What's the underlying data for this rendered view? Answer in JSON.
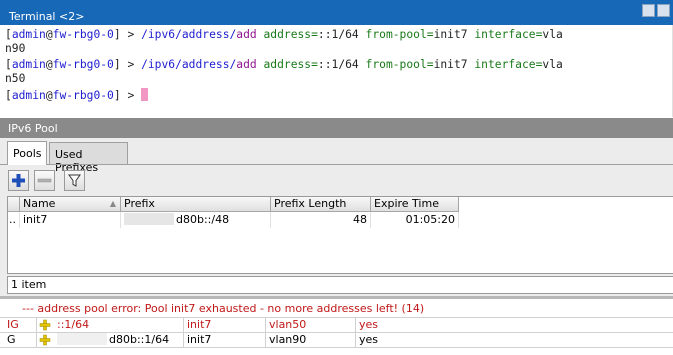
{
  "terminal": {
    "title": "Terminal <2>",
    "lines": [
      {
        "l": "[",
        "user": "admin",
        "at": "@",
        "host": "fw-rbg0-0",
        "r": "] > ",
        "path": "/ipv6/address/",
        "cmd": "add",
        "args": [
          {
            "k": " address=",
            "v": "::1/64"
          },
          {
            "k": " from-pool=",
            "v": "init7"
          },
          {
            "k": " interface=",
            "v": "vla"
          }
        ],
        "wrap": "n90"
      },
      {
        "l": "[",
        "user": "admin",
        "at": "@",
        "host": "fw-rbg0-0",
        "r": "] > ",
        "path": "/ipv6/address/",
        "cmd": "add",
        "args": [
          {
            "k": " address=",
            "v": "::1/64"
          },
          {
            "k": " from-pool=",
            "v": "init7"
          },
          {
            "k": " interface=",
            "v": "vla"
          }
        ],
        "wrap": "n50"
      }
    ],
    "prompt": {
      "l": "[",
      "user": "admin",
      "at": "@",
      "host": "fw-rbg0-0",
      "r": "] > "
    }
  },
  "pool_window": {
    "title": "IPv6 Pool",
    "tabs": [
      "Pools",
      "Used Prefixes"
    ],
    "active_tab": 0,
    "toolbar": [
      "add-icon",
      "remove-icon",
      "filter-icon"
    ],
    "columns": [
      "Name",
      "Prefix",
      "Prefix Length",
      "Expire Time"
    ],
    "rows": [
      {
        "marker": "..",
        "name": "init7",
        "prefix": "d80b::/48",
        "prefix_length": "48",
        "expire_time": "01:05:20"
      }
    ],
    "status": "1 item"
  },
  "log": {
    "error": "--- address pool error: Pool init7 exhausted - no more addresses left! (14)",
    "rows": [
      {
        "flags": "IG",
        "address": "::1/64",
        "pool": "init7",
        "interface": "vlan50",
        "advertise": "yes",
        "invalid": true
      },
      {
        "flags": "G",
        "address": "d80b::1/64",
        "pool": "init7",
        "interface": "vlan90",
        "advertise": "yes",
        "invalid": false
      }
    ]
  },
  "colors": {
    "title_active": "#1868b8",
    "title_inactive": "#8a8a8a",
    "error": "#c01818",
    "cursor": "#f296c4",
    "add_icon": "#1e4fb8"
  }
}
